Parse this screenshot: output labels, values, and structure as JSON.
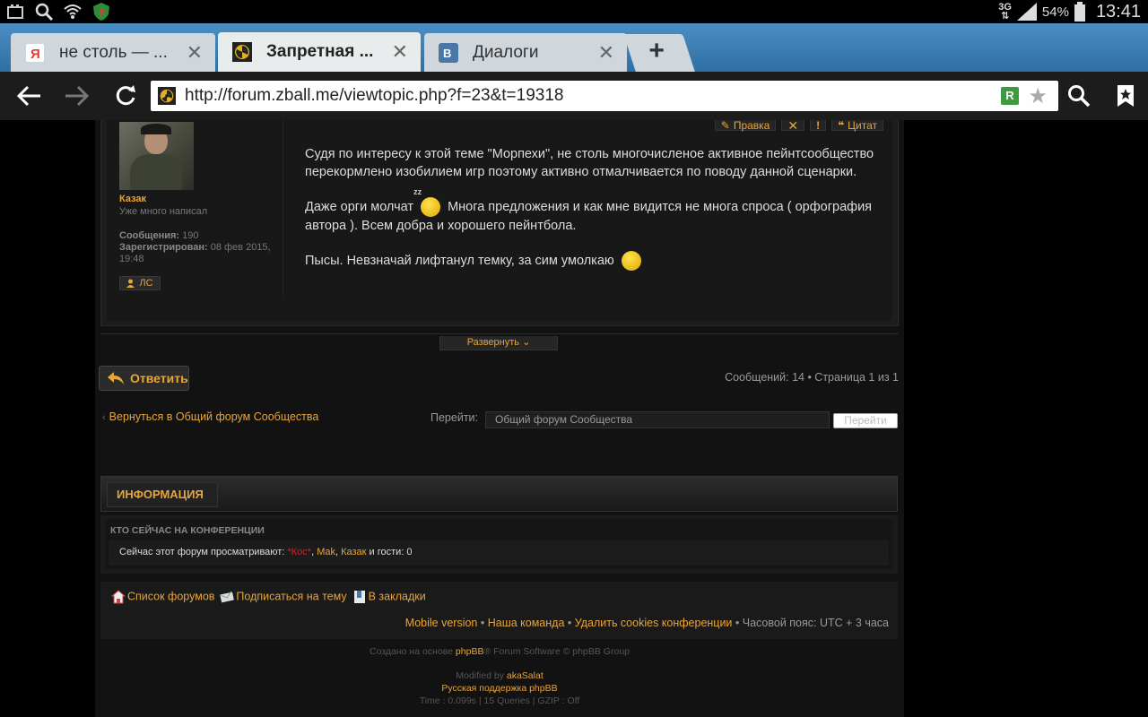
{
  "status_bar": {
    "network": "3G",
    "battery": "54%",
    "time": "13:41"
  },
  "tabs": [
    {
      "title": "не столь — ...",
      "favicon": "yandex-icon",
      "active": false
    },
    {
      "title": "Запретная ...",
      "favicon": "radiation-icon",
      "active": true
    },
    {
      "title": "Диалоги",
      "favicon": "vk-icon",
      "active": false
    }
  ],
  "toolbar": {
    "url": "http://forum.zball.me/viewtopic.php?f=23&t=19318"
  },
  "post": {
    "author": "Казак",
    "rank": "Уже много написал",
    "posts_label": "Сообщения:",
    "posts_value": "190",
    "registered_label": "Зарегистрирован:",
    "registered_value": "08 фев 2015, 19:48",
    "pm_label": "ЛС",
    "tools": {
      "edit": "Правка",
      "quote": "Цитат"
    },
    "p1": "Судя по интересу к этой теме \"Морпехи\", не столь многочисленое активное пейнтсообщество перекормлено изобилием игр поэтому активно отмалчивается по поводу данной сценарки.",
    "p2a": "Даже орги молчат",
    "p2b": "Многа предложения и как мне видится не многа спроса ( орфография автора ). Всем добра и хорошего пейнтбола.",
    "p3": "Пысы. Невзначай лифтанул темку, за сим умолкаю"
  },
  "expand_label": "Развернуть",
  "reply_label": "Ответить",
  "pagination": "Сообщений: 14 • Страница 1 из 1",
  "back_link": "Вернуться в Общий форум Сообщества",
  "jump": {
    "label": "Перейти:",
    "selected": "Общий форум Сообщества",
    "go": "Перейти"
  },
  "info": {
    "header": "ИНФОРМАЦИЯ",
    "online_title": "КТО СЕЙЧАС НА КОНФЕРЕНЦИИ",
    "online_prefix": "Сейчас этот форум просматривают:",
    "user1": "*Кос*",
    "user2": "Mak",
    "user3": "Казак",
    "online_suffix": "и гости: 0"
  },
  "footer": {
    "forum_list": "Список форумов",
    "subscribe": "Подписаться на тему",
    "bookmarks": "В закладки",
    "mobile": "Mobile version",
    "team": "Наша команда",
    "delete_cookies": "Удалить cookies конференции",
    "timezone": "Часовой пояс: UTC + 3 часа"
  },
  "credits": {
    "line1_pre": "Создано на основе",
    "line1_link": "phpBB",
    "line1_post": "® Forum Software © phpBB Group",
    "line2_pre": "Modified by",
    "line2_link": "akaSalat",
    "line3": "Русская поддержка phpBB",
    "line4": "Time : 0.099s | 15 Queries | GZIP : Off"
  },
  "colors": {
    "accent": "#e8a53a",
    "tabstrip": "#3a7fb5",
    "page_bg": "#121212"
  }
}
